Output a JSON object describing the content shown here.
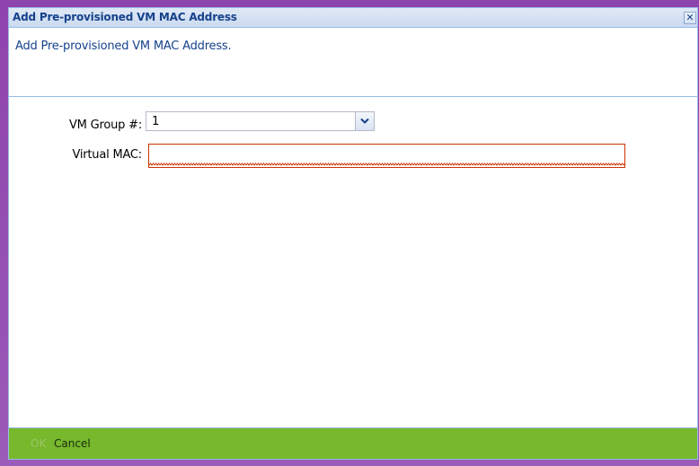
{
  "dialog": {
    "title": "Add Pre-provisioned VM MAC Address",
    "close_glyph": "✕",
    "close_icon": "close-icon",
    "description": "Add Pre-provisioned VM MAC Address."
  },
  "form": {
    "vm_group": {
      "label": "VM Group #:",
      "value": "1",
      "trigger_icon": "chevron-down-icon"
    },
    "virtual_mac": {
      "label": "Virtual MAC:",
      "value": "",
      "placeholder": "",
      "state": "invalid"
    }
  },
  "footer": {
    "ok_label": "OK",
    "cancel_label": "Cancel",
    "ok_enabled": false
  },
  "colors": {
    "frame": "#9b59b6",
    "title_text": "#15428b",
    "footer_bg": "#77b82c",
    "invalid_border": "#cc3300"
  }
}
